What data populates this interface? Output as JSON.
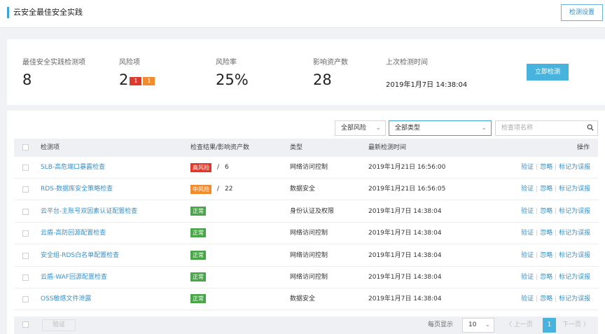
{
  "header": {
    "title": "云安全最佳安全实践",
    "settings_label": "检测设置"
  },
  "stats": {
    "items_label": "最佳安全实践检测项",
    "items_value": "8",
    "risk_label": "风险项",
    "risk_value": "2",
    "risk_high_badge": "1",
    "risk_mid_badge": "1",
    "rate_label": "风险率",
    "rate_value": "25%",
    "assets_label": "影响资产数",
    "assets_value": "28",
    "last_label": "上次检测时间",
    "last_value": "2019年1月7日 14:38:04",
    "check_now_label": "立即检测"
  },
  "filters": {
    "risk": "全部风险",
    "type": "全部类型",
    "search_placeholder": "检查项名称"
  },
  "table": {
    "headers": {
      "item": "检测项",
      "result": "检查结果/影响资产数",
      "type": "类型",
      "time": "最新检测时间",
      "ops": "操作"
    },
    "actions": {
      "verify": "验证",
      "ignore": "忽略",
      "mark": "标记为误报"
    },
    "rows": [
      {
        "name": "SLB-高危端口暴露检查",
        "status": "高风险",
        "count": "6",
        "type": "网络访问控制",
        "time": "2019年1月21日 16:56:00"
      },
      {
        "name": "RDS-数据库安全策略检查",
        "status": "中风险",
        "count": "22",
        "type": "数据安全",
        "time": "2019年1月21日 16:56:05"
      },
      {
        "name": "云平台-主账号双因素认证配置检查",
        "status": "正常",
        "count": "",
        "type": "身份认证及权限",
        "time": "2019年1月7日 14:38:04"
      },
      {
        "name": "云盾-高防回源配置检查",
        "status": "正常",
        "count": "",
        "type": "网络访问控制",
        "time": "2019年1月7日 14:38:04"
      },
      {
        "name": "安全组-RDS白名单配置检查",
        "status": "正常",
        "count": "",
        "type": "网络访问控制",
        "time": "2019年1月7日 14:38:04"
      },
      {
        "name": "云盾-WAF回源配置检查",
        "status": "正常",
        "count": "",
        "type": "网络访问控制",
        "time": "2019年1月7日 14:38:04"
      },
      {
        "name": "OSS敏感文件泄露",
        "status": "正常",
        "count": "",
        "type": "数据安全",
        "time": "2019年1月7日 14:38:04"
      }
    ]
  },
  "footer": {
    "verify_label": "验证",
    "per_page_label": "每页显示",
    "per_page_value": "10",
    "prev_label": "〈 上一页",
    "current_page": "1",
    "next_label": "下一页 〉"
  },
  "colors": {
    "high": "#e0392b",
    "mid": "#f08c2e",
    "normal": "#4aa54a",
    "accent": "#48b4dd"
  },
  "icons": [
    "search-icon",
    "chevron-down-icon",
    "checkbox-icon"
  ]
}
